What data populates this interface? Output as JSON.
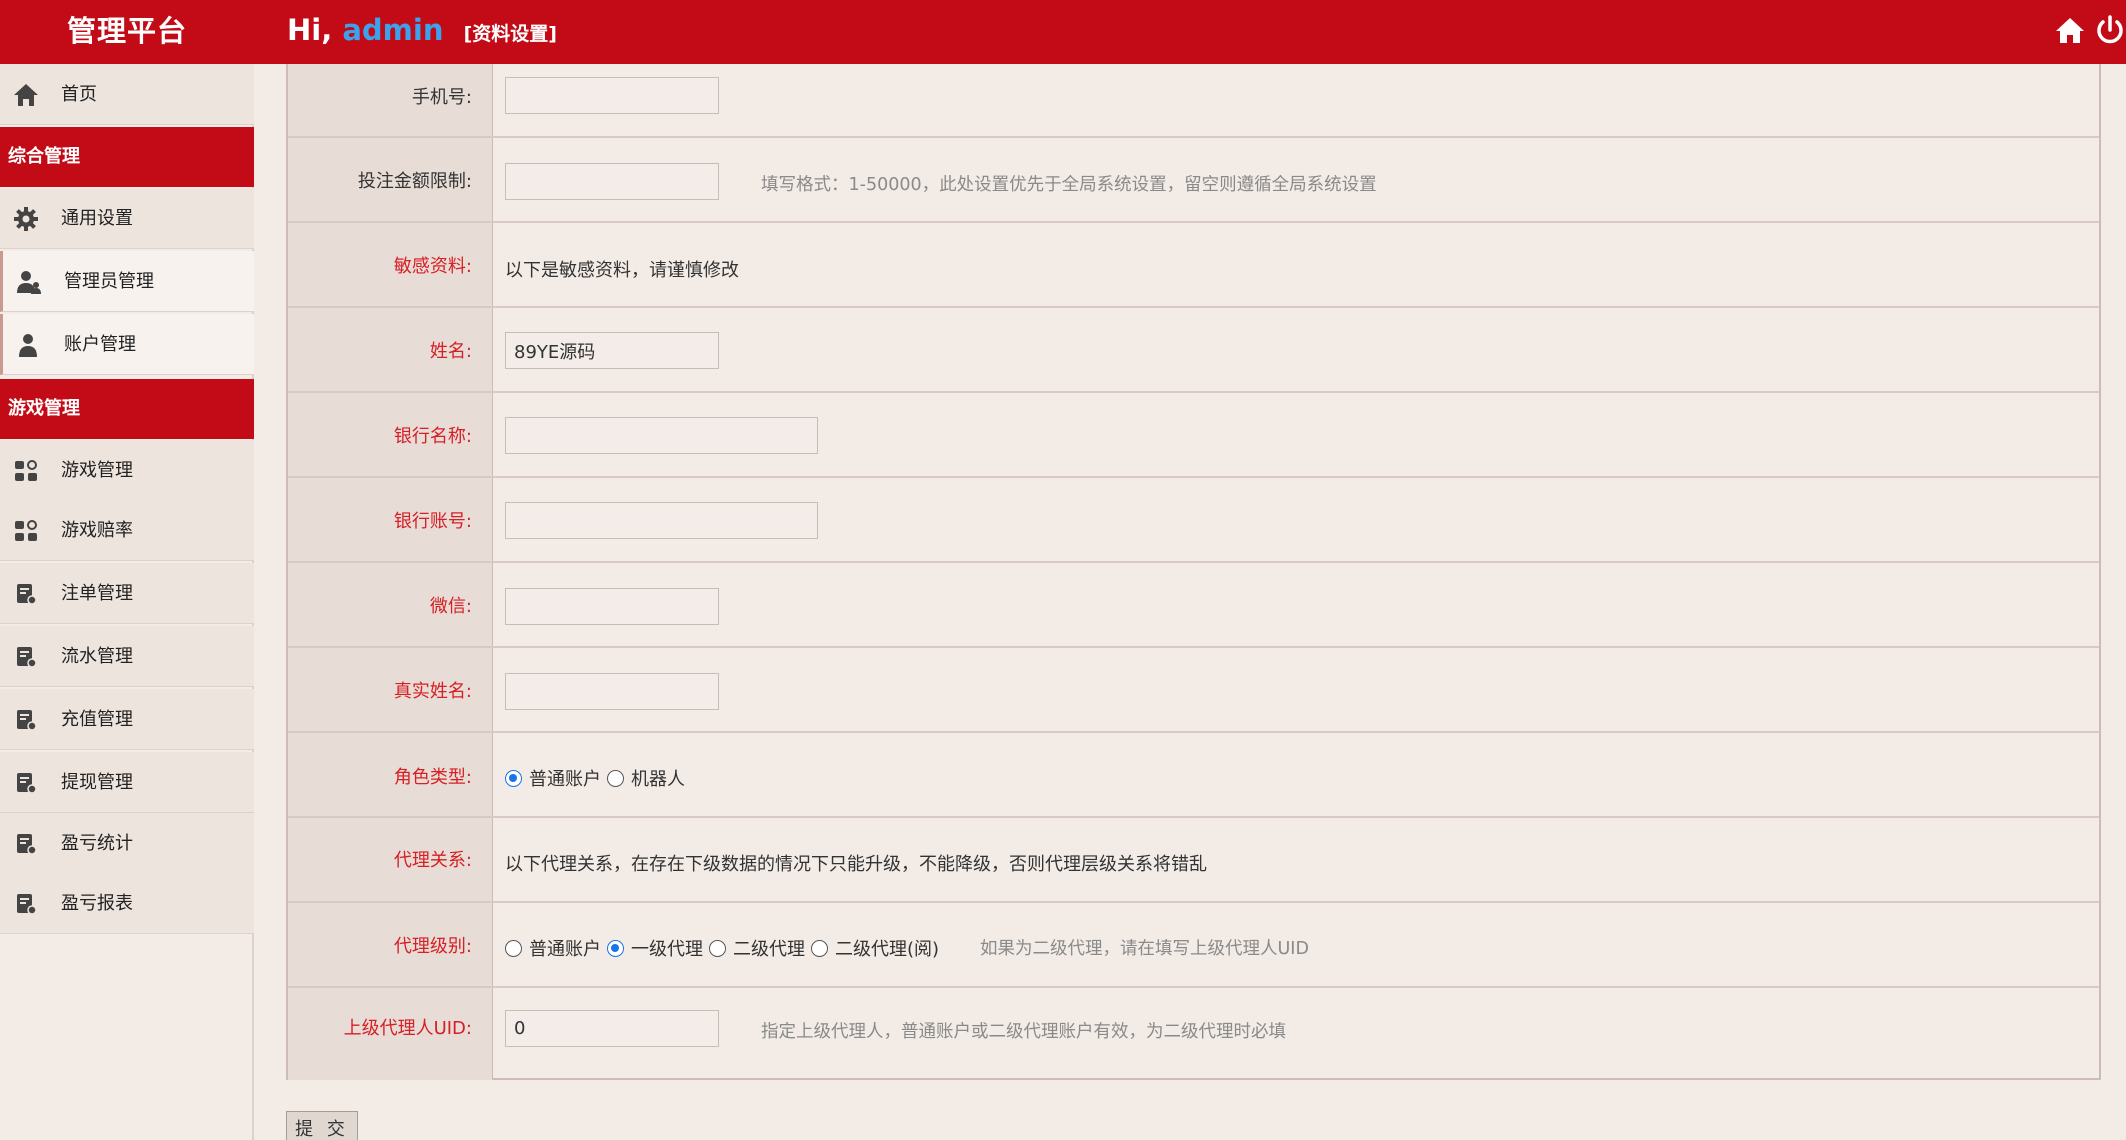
{
  "header": {
    "brand": "管理平台",
    "greeting": "Hi,",
    "username": "admin",
    "profile_link": "[资料设置]",
    "icons": [
      "home-icon",
      "power-icon"
    ]
  },
  "sidebar": {
    "home": {
      "label": "首页",
      "icon": "home-icon"
    },
    "section_general": "综合管理",
    "general_items": [
      {
        "label": "通用设置",
        "icon": "gear-icon"
      },
      {
        "label": "管理员管理",
        "icon": "users-icon"
      },
      {
        "label": "账户管理",
        "icon": "user-icon"
      }
    ],
    "section_game": "游戏管理",
    "game_items": [
      {
        "label": "游戏管理",
        "icon": "apps-icon"
      },
      {
        "label": "游戏赔率",
        "icon": "apps-icon"
      },
      {
        "label": "注单管理",
        "icon": "document-icon"
      },
      {
        "label": "流水管理",
        "icon": "document-icon"
      },
      {
        "label": "充值管理",
        "icon": "document-icon"
      },
      {
        "label": "提现管理",
        "icon": "document-icon"
      },
      {
        "label": "盈亏统计",
        "icon": "document-icon"
      },
      {
        "label": "盈亏报表",
        "icon": "document-icon"
      }
    ]
  },
  "form": {
    "phone": {
      "label": "手机号:",
      "value": ""
    },
    "bet_limit": {
      "label": "投注金额限制:",
      "value": "",
      "hint": "填写格式：1-50000，此处设置优先于全局系统设置，留空则遵循全局系统设置"
    },
    "sensitive": {
      "label": "敏感资料:",
      "text": "以下是敏感资料，请谨慎修改"
    },
    "name": {
      "label": "姓名:",
      "value": "89YE源码"
    },
    "bank_name": {
      "label": "银行名称:",
      "value": ""
    },
    "bank_account": {
      "label": "银行账号:",
      "value": ""
    },
    "wechat": {
      "label": "微信:",
      "value": ""
    },
    "real_name": {
      "label": "真实姓名:",
      "value": ""
    },
    "role_type": {
      "label": "角色类型:",
      "options": [
        "普通账户",
        "机器人"
      ],
      "selected": "普通账户"
    },
    "agent_relation": {
      "label": "代理关系:",
      "text": "以下代理关系，在存在下级数据的情况下只能升级，不能降级，否则代理层级关系将错乱"
    },
    "agent_level": {
      "label": "代理级别:",
      "options": [
        "普通账户",
        "一级代理",
        "二级代理",
        "二级代理(阅)"
      ],
      "selected": "一级代理",
      "hint": "如果为二级代理，请在填写上级代理人UID"
    },
    "parent_uid": {
      "label": "上级代理人UID:",
      "value": "0",
      "hint": "指定上级代理人，普通账户或二级代理账户有效，为二级代理时必填"
    },
    "submit_label": "提 交"
  }
}
